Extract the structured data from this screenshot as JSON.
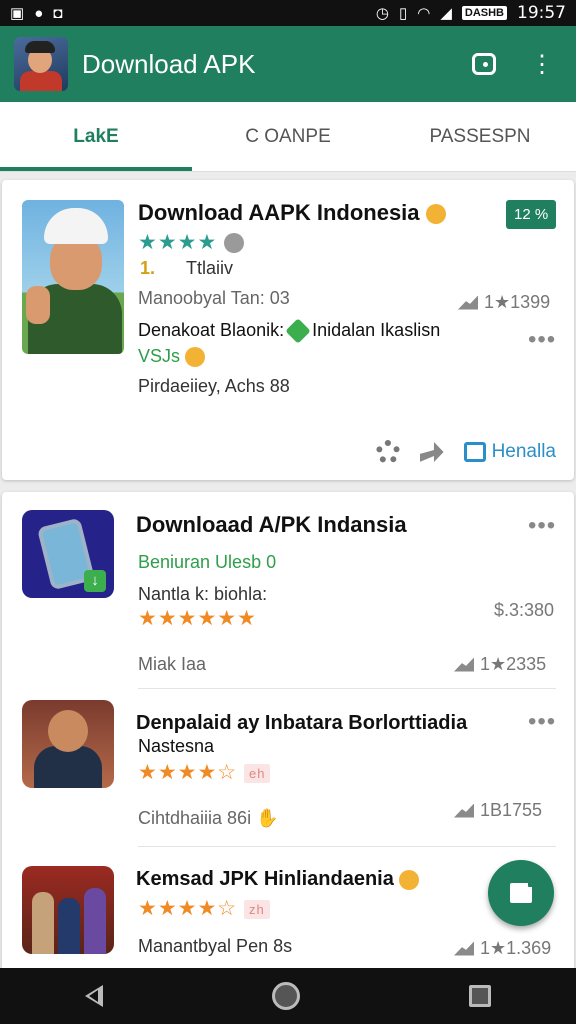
{
  "status_bar": {
    "left_icons": [
      "gallery-icon",
      "record-icon",
      "notification-icon"
    ],
    "right_icons": [
      "alarm-icon",
      "vibrate-icon",
      "wifi-icon",
      "signal-icon"
    ],
    "battery_label": "DASHB",
    "time": "19:57"
  },
  "app_bar": {
    "title": "Download APK",
    "icons": [
      "chat-icon",
      "more-vert-icon"
    ]
  },
  "tabs": [
    "LakE",
    "C OANPE",
    "PASSESPN"
  ],
  "card1": {
    "title": "Download AAPK Indonesia",
    "badge": "12 %",
    "stars": "★★★★",
    "rating_number": "1.",
    "rating_label": "Ttlaiiv",
    "meta": "Manoobyal Tan: 03",
    "count": "1★1399",
    "line1_a": "Denakoat Blaonik:",
    "line1_b": "Inidalan Ikaslisn",
    "line2": "VSJs",
    "line3": "Pirdaeiiey, Achs 88",
    "install_label": "Henalla"
  },
  "list": [
    {
      "title": "Downloaad A/PK Indansia",
      "subtitle": "Beniuran Ulesb 0",
      "line": "Nantla k: biohla:",
      "stars": "★★★★★★",
      "price": "$.3:380",
      "meta": "Miak Iaa",
      "count": "1★2335"
    },
    {
      "title": "Denpalaid ay Inbatara Borlorttiadia",
      "title2": "Nastesna",
      "stars": "★★★★☆",
      "tag": "eh",
      "meta": "Cihtdhaiiia 86i",
      "count": "1B1755"
    },
    {
      "title": "Kemsad JPK Hinliandaenia",
      "stars": "★★★★☆",
      "tag": "zh",
      "meta": "Manantbyal Pen 8s",
      "count": "1★1.369"
    }
  ],
  "colors": {
    "primary": "#1f7f5e",
    "star_teal": "#2a9d8f",
    "star_gold": "#f2b233",
    "star_orange": "#f08a24",
    "link_blue": "#2a8fc8"
  }
}
